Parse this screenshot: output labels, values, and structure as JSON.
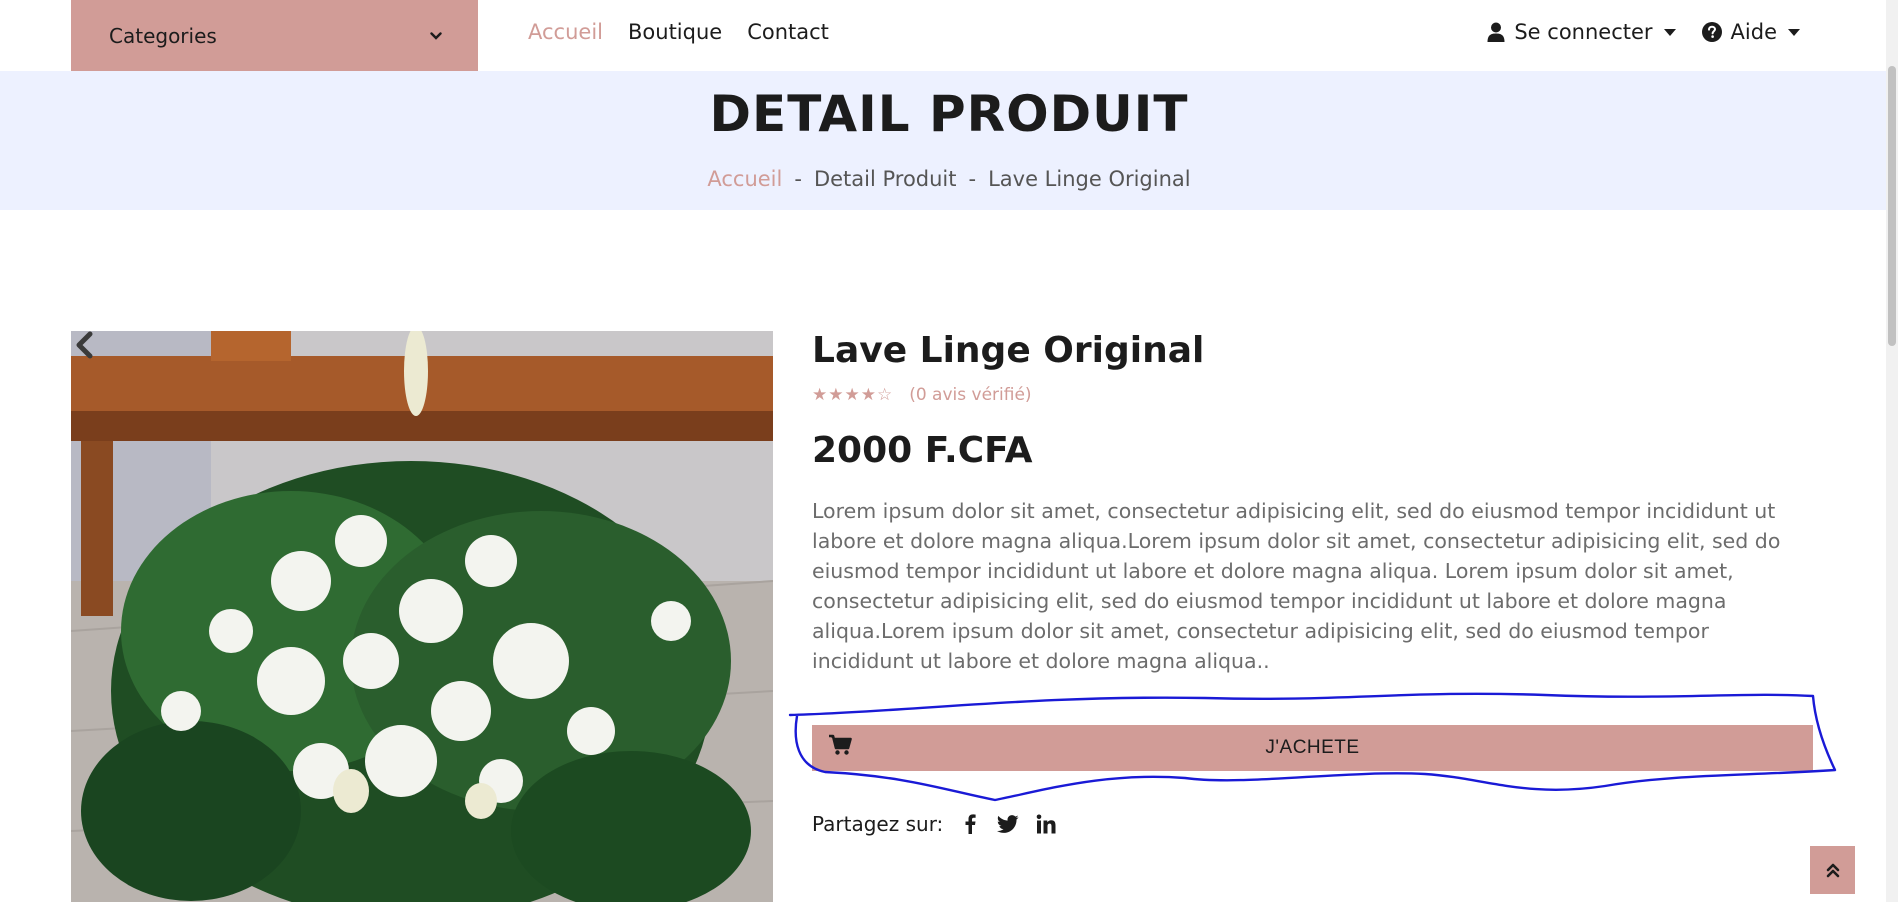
{
  "nav": {
    "categories_label": "Categories",
    "links": [
      "Accueil",
      "Boutique",
      "Contact"
    ],
    "login_label": "Se connecter",
    "help_label": "Aide"
  },
  "page_header": {
    "title": "DETAIL PRODUIT",
    "breadcrumb": [
      "Accueil",
      "-",
      "Detail Produit",
      "-",
      "Lave Linge Original"
    ]
  },
  "product": {
    "name": "Lave Linge Original",
    "stars": "★★★★☆",
    "rating_value": 4,
    "rating_max": 5,
    "reviews": "(0 avis vérifié)",
    "price": "2000 F.CFA",
    "description": "Lorem ipsum dolor sit amet, consectetur adipisicing elit, sed do eiusmod tempor incididunt ut labore et dolore magna aliqua.Lorem ipsum dolor sit amet, consectetur adipisicing elit, sed do eiusmod tempor incididunt ut labore et dolore magna aliqua. Lorem ipsum dolor sit amet, consectetur adipisicing elit, sed do eiusmod tempor incididunt ut labore et dolore magna aliqua.Lorem ipsum dolor sit amet, consectetur adipisicing elit, sed do eiusmod tempor incididunt ut labore et dolore magna aliqua..",
    "buy_label": "J'ACHETE"
  },
  "share": {
    "label": "Partagez sur:",
    "networks": [
      "facebook-icon",
      "twitter-icon",
      "linkedin-icon"
    ]
  },
  "colors": {
    "accent": "#d19c97",
    "header_bg": "#edf1ff",
    "annotation": "#1a1ad6"
  }
}
